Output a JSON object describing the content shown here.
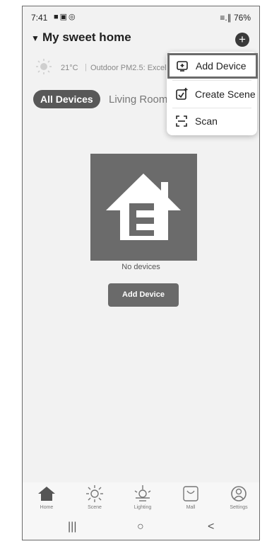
{
  "status": {
    "time": "7:41",
    "left_icons": "■▣◎",
    "right_text": "≡.∥ 76%"
  },
  "header": {
    "title": "My sweet home",
    "caret": "▼",
    "plus_symbol": "+"
  },
  "weather": {
    "temperature": "21°C",
    "pm_text": "Outdoor PM2.5: Excellent"
  },
  "tabs": [
    {
      "label": "All Devices",
      "active": true
    },
    {
      "label": "Living Room",
      "active": false
    }
  ],
  "popup_menu": {
    "items": [
      {
        "label": "Add Device",
        "icon": "add-device-icon"
      },
      {
        "label": "Create Scene",
        "icon": "create-scene-icon"
      },
      {
        "label": "Scan",
        "icon": "scan-icon"
      }
    ]
  },
  "empty_state": {
    "message": "No devices",
    "button_label": "Add Device"
  },
  "bottom_nav": [
    {
      "label": "Home",
      "icon": "home-icon"
    },
    {
      "label": "Scene",
      "icon": "scene-icon"
    },
    {
      "label": "Lighting",
      "icon": "lighting-icon"
    },
    {
      "label": "Mall",
      "icon": "mall-icon"
    },
    {
      "label": "Settings",
      "icon": "settings-icon"
    }
  ],
  "system_nav": {
    "recents": "|||",
    "home": "○",
    "back": "<"
  },
  "colors": {
    "accent": "#585858",
    "frame_bg": "#f2f2f2",
    "menu_highlight_border": "#6b6b6b"
  }
}
